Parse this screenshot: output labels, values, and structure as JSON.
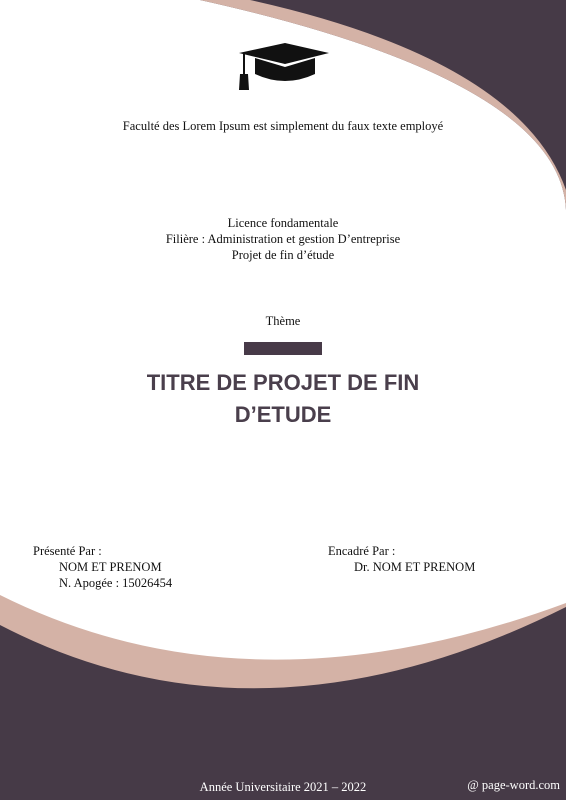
{
  "header": {
    "faculty": "Faculté des Lorem Ipsum est simplement du faux texte employé"
  },
  "program": {
    "lines": [
      "Licence fondamentale",
      "Filière : Administration et gestion D’entreprise",
      "Projet de fin d’étude"
    ]
  },
  "theme": {
    "label": "Thème",
    "title_lines": [
      "TITRE DE PROJET DE FIN",
      "D’ETUDE"
    ]
  },
  "presented": {
    "label": "Présenté Par :",
    "name": "NOM ET PRENOM",
    "apogee": "N. Apogée : 15026454"
  },
  "supervised": {
    "label": "Encadré Par :",
    "name": "Dr. NOM ET PRENOM"
  },
  "footer": {
    "year": "Année Universitaire 2021 – 2022",
    "credit": "@ page-word.com"
  },
  "icons": {
    "logo": "graduation-cap-icon"
  },
  "colors": {
    "dark": "#463a47",
    "accent": "#d4b2a6",
    "background": "#ffffff",
    "title": "#4a3f4c"
  }
}
